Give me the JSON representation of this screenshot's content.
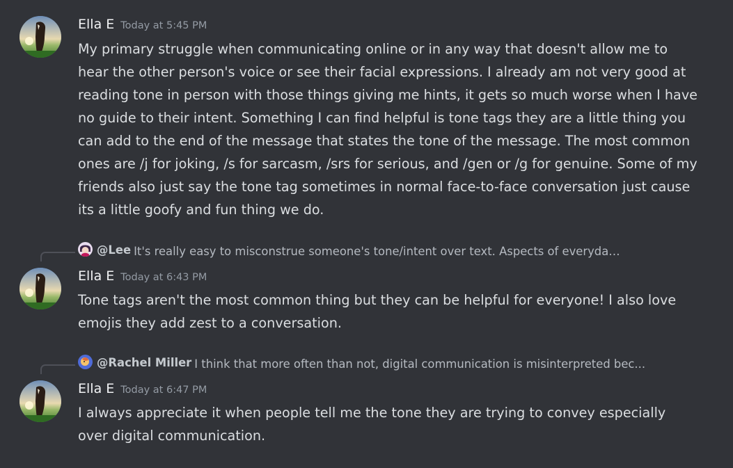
{
  "messages": [
    {
      "author": "Ella E",
      "timestamp": "Today at 5:45 PM",
      "content": "My primary struggle when communicating online or in any way that doesn't allow me to hear the other person's voice or see their facial expressions. I already am not very good at reading tone in person with those things giving me hints, it gets so much worse when I have no guide to their intent. Something I can find helpful is tone tags they are a little thing you can add to the end of the message that states the tone of the message. The most common ones are /j for joking, /s for sarcasm, /srs for serious, and /gen or /g for genuine. Some of my friends also just say the tone tag sometimes in normal face-to-face conversation just cause its a little goofy and fun thing we do."
    },
    {
      "author": "Ella E",
      "timestamp": "Today at 6:43 PM",
      "reply": {
        "user": "@Lee",
        "text": "It's really easy to misconstrue someone's tone/intent over text. Aspects of everyday in p...",
        "avatar_icon": "anime-avatar-icon"
      },
      "content": "Tone tags aren't the most common thing but they can be helpful for everyone! I also love emojis they add zest to a conversation."
    },
    {
      "author": "Ella E",
      "timestamp": "Today at 6:47 PM",
      "reply": {
        "user": "@Rachel  Miller",
        "text": "I think that more often than not, digital communication is misinterpreted bec...",
        "avatar_icon": "cartoon-avatar-icon"
      },
      "content": "I always appreciate it when people tell me the tone they are trying to convey especially over digital communication."
    }
  ],
  "colors": {
    "background": "#313338",
    "author": "#f2f3f5",
    "timestamp": "#949ba4",
    "text": "#dbdee1"
  }
}
